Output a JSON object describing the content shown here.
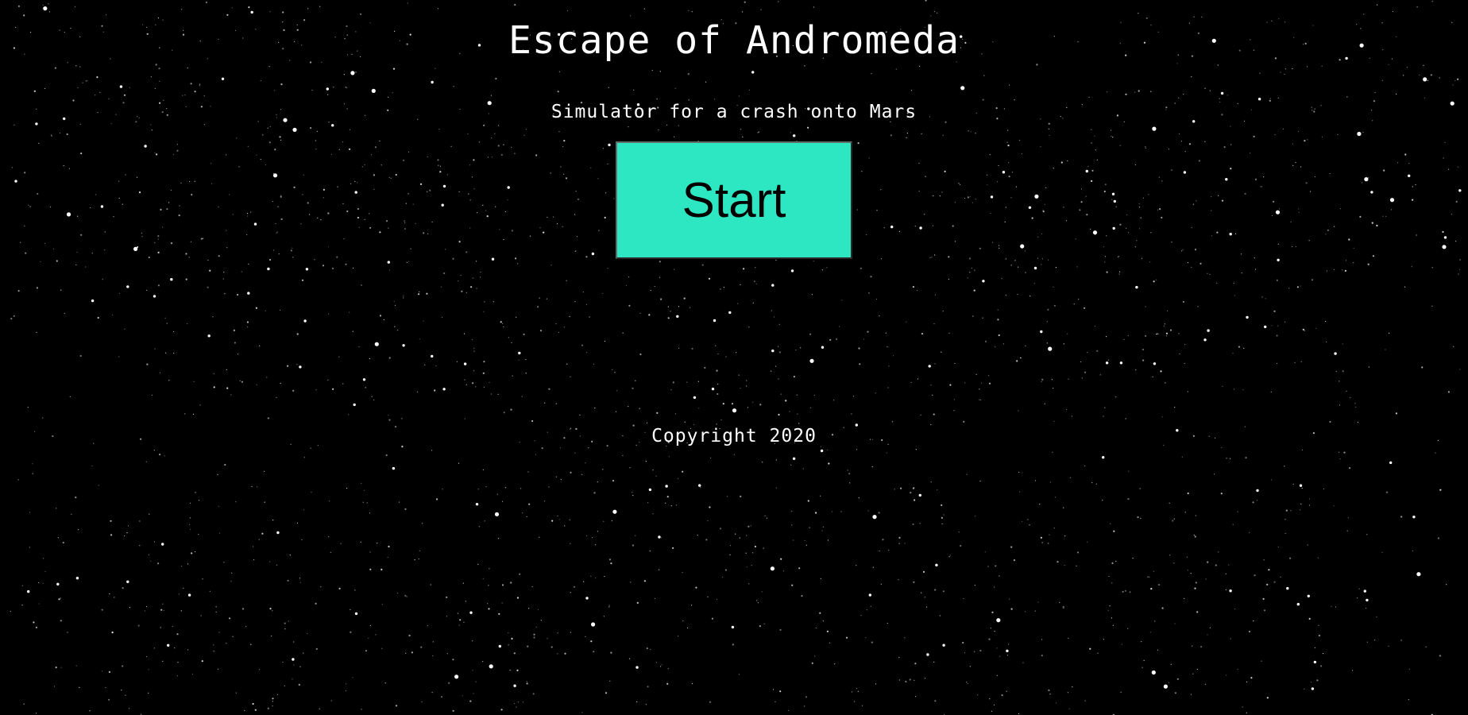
{
  "header": {
    "title": "Escape of Andromeda",
    "subtitle": "Simulator for a crash onto Mars"
  },
  "controls": {
    "start_label": "Start",
    "start_color": "#2de6c2"
  },
  "footer": {
    "copyright": "Copyright 2020"
  },
  "background": {
    "color": "#000000",
    "texture": "starfield"
  }
}
